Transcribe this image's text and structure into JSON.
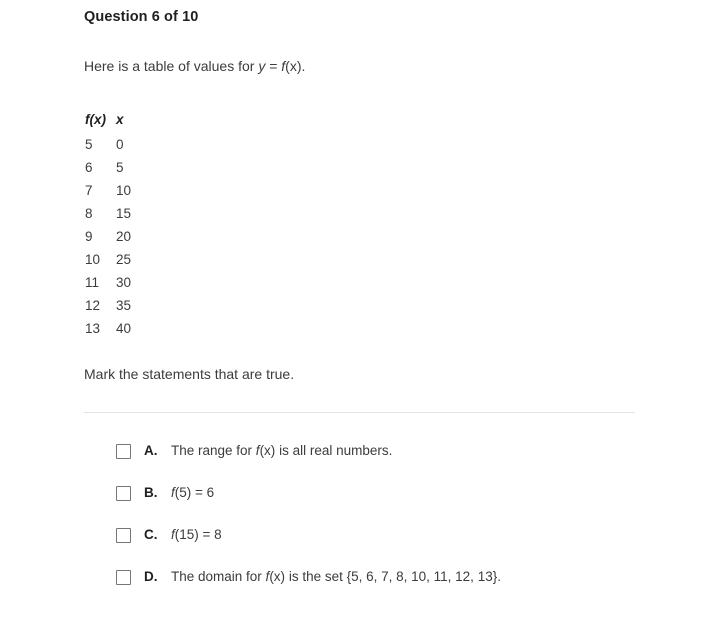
{
  "question": {
    "heading": "Question 6 of 10",
    "prompt_prefix": "Here is a table of values for ",
    "prompt_y": "y",
    "prompt_eq": " = ",
    "prompt_f": "f",
    "prompt_arg": "(x)",
    "prompt_suffix": ".",
    "instruction": "Mark the statements that are true."
  },
  "table": {
    "headers": [
      "f(x)",
      "x"
    ],
    "header_fx_f": "f",
    "header_fx_rest": "(x)",
    "header_x": "x",
    "rows": [
      {
        "fx": "5",
        "x": "0"
      },
      {
        "fx": "6",
        "x": "5"
      },
      {
        "fx": "7",
        "x": "10"
      },
      {
        "fx": "8",
        "x": "15"
      },
      {
        "fx": "9",
        "x": "20"
      },
      {
        "fx": "10",
        "x": "25"
      },
      {
        "fx": "11",
        "x": "30"
      },
      {
        "fx": "12",
        "x": "35"
      },
      {
        "fx": "13",
        "x": "40"
      }
    ]
  },
  "options": [
    {
      "letter": "A.",
      "text": "The range for f(x) is all real numbers.",
      "pre": "The range for ",
      "italic_f": "f",
      "arg": "(x)",
      "post": " is all real numbers.",
      "checked": false
    },
    {
      "letter": "B.",
      "text": "f(5) = 6",
      "pre": "",
      "italic_f": "f",
      "arg": "(5)",
      "post": " = 6",
      "checked": false
    },
    {
      "letter": "C.",
      "text": "f(15) = 8",
      "pre": "",
      "italic_f": "f",
      "arg": "(15)",
      "post": " = 8",
      "checked": false
    },
    {
      "letter": "D.",
      "text": "The domain for f(x) is the set {5, 6, 7, 8, 10, 11, 12, 13}.",
      "pre": "The domain for ",
      "italic_f": "f",
      "arg": "(x)",
      "post": " is the set {5, 6, 7, 8, 10, 11, 12, 13}.",
      "checked": false
    }
  ],
  "colors": {
    "background": "#ffffff",
    "heading_text": "#1f1f1f",
    "body_text": "#3c3c3c",
    "divider": "#e3e3e3",
    "checkbox_border": "#767676"
  }
}
